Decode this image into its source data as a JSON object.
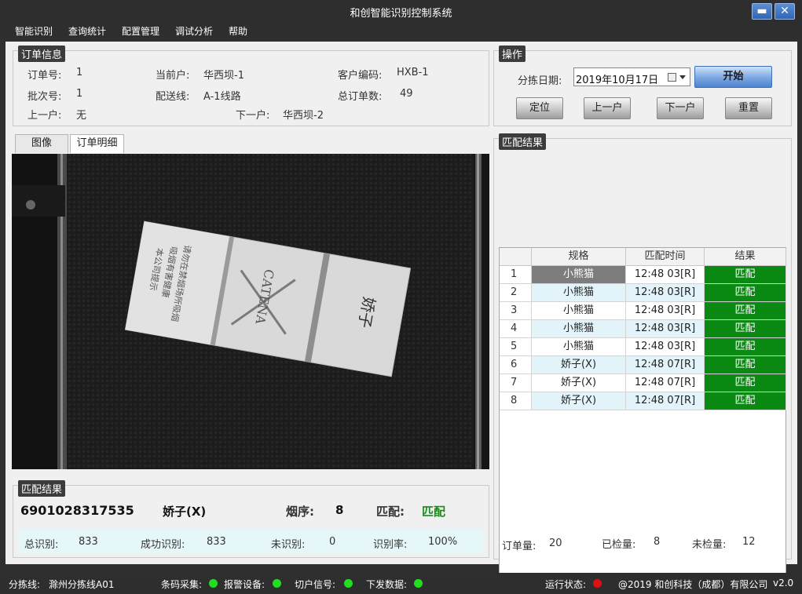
{
  "window": {
    "title": "和创智能识别控制系统",
    "min_label": "▬",
    "close_label": "✕"
  },
  "menu": [
    "智能识别",
    "查询统计",
    "配置管理",
    "调试分析",
    "帮助"
  ],
  "order_info": {
    "title": "订单信息",
    "order_no_label": "订单号:",
    "order_no": "1",
    "current_label": "当前户:",
    "current": "华西坝-1",
    "customer_code_label": "客户编码:",
    "customer_code": "HXB-1",
    "batch_label": "批次号:",
    "batch": "1",
    "route_label": "配送线:",
    "route": "A-1线路",
    "total_orders_label": "总订单数:",
    "total_orders": "49",
    "prev_label": "上一户:",
    "prev": "无",
    "next_label": "下一户:",
    "next": "华西坝-2"
  },
  "operation": {
    "title": "操作",
    "date_label": "分拣日期:",
    "date_value": "2019年10月17日",
    "start": "开始",
    "locate": "定位",
    "prev": "上一户",
    "next": "下一户",
    "reset": "重置"
  },
  "tabs": [
    "图像",
    "订单明细"
  ],
  "image": {
    "pack_brand": "娇子",
    "pack_text": [
      "本公司提示",
      "吸烟有害健康",
      "请勿在禁烟场所吸烟"
    ],
    "pack_logo": "CATENA"
  },
  "match_result_bottom": {
    "title": "匹配结果",
    "barcode": "6901028317535",
    "product": "娇子(X)",
    "seq_label": "烟序:",
    "seq": "8",
    "match_label": "匹配:",
    "match": "匹配",
    "total_label": "总识别:",
    "total": "833",
    "success_label": "成功识别:",
    "success": "833",
    "unrecognized_label": "未识别:",
    "unrecognized": "0",
    "rate_label": "识别率:",
    "rate": "100%"
  },
  "match_table": {
    "title": "匹配结果",
    "columns": [
      "规格",
      "匹配时间",
      "结果"
    ],
    "rows": [
      {
        "idx": "1",
        "spec": "小熊猫",
        "time": "12:48 03[R]",
        "result": "匹配"
      },
      {
        "idx": "2",
        "spec": "小熊猫",
        "time": "12:48 03[R]",
        "result": "匹配"
      },
      {
        "idx": "3",
        "spec": "小熊猫",
        "time": "12:48 03[R]",
        "result": "匹配"
      },
      {
        "idx": "4",
        "spec": "小熊猫",
        "time": "12:48 03[R]",
        "result": "匹配"
      },
      {
        "idx": "5",
        "spec": "小熊猫",
        "time": "12:48 03[R]",
        "result": "匹配"
      },
      {
        "idx": "6",
        "spec": "娇子(X)",
        "time": "12:48 07[R]",
        "result": "匹配"
      },
      {
        "idx": "7",
        "spec": "娇子(X)",
        "time": "12:48 07[R]",
        "result": "匹配"
      },
      {
        "idx": "8",
        "spec": "娇子(X)",
        "time": "12:48 07[R]",
        "result": "匹配"
      }
    ],
    "order_qty_label": "订单量:",
    "order_qty": "20",
    "checked_label": "已检量:",
    "checked": "8",
    "unchecked_label": "未检量:",
    "unchecked": "12"
  },
  "status": {
    "line_label": "分拣线:",
    "line": "滁州分拣线A01",
    "barcode_label": "条码采集:",
    "alarm_label": "报警设备:",
    "cut_label": "切户信号:",
    "send_label": "下发数据:",
    "run_label": "运行状态:",
    "copyright": "@2019 和创科技（成都）有限公司",
    "version": "v2.0",
    "ok_color": "#22dd22",
    "run_color": "#dd1111"
  }
}
